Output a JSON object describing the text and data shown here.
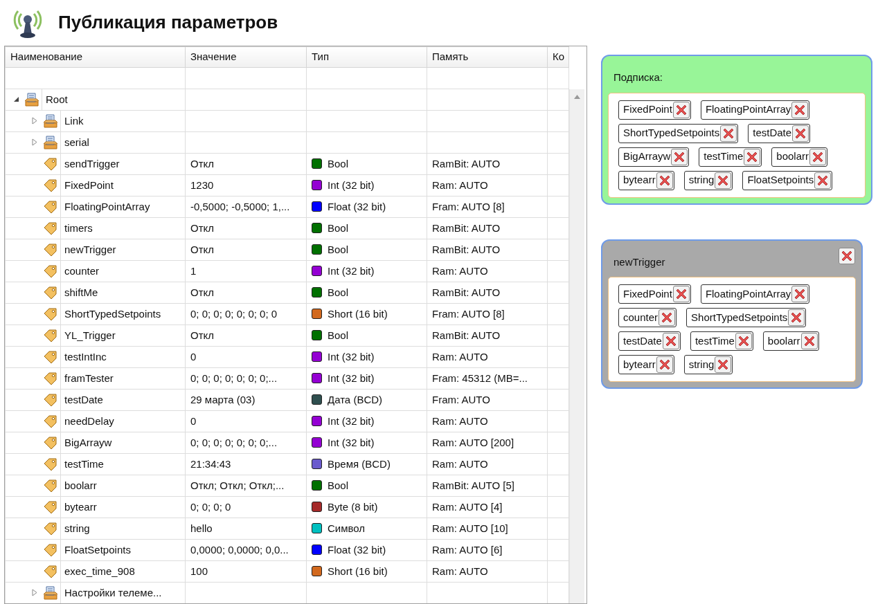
{
  "title": "Публикация параметров",
  "table": {
    "columns": [
      "Наименование",
      "Значение",
      "Тип",
      "Память",
      "Ко"
    ],
    "tree": [
      {
        "kind": "folder",
        "label": "Root",
        "expanded": true,
        "children": [
          {
            "kind": "folder",
            "label": "Link",
            "expanded": false
          },
          {
            "kind": "folder",
            "label": "serial",
            "expanded": false
          },
          {
            "kind": "param",
            "label": "sendTrigger",
            "value": "Откл",
            "type": "Bool",
            "color": "#007000",
            "memory": "RamBit: AUTO"
          },
          {
            "kind": "param",
            "label": "FixedPoint",
            "value": "1230",
            "type": "Int (32 bit)",
            "color": "#9400d3",
            "memory": "Ram: AUTO"
          },
          {
            "kind": "param",
            "label": "FloatingPointArray",
            "value": "-0,5000; -0,5000; 1,...",
            "type": "Float (32 bit)",
            "color": "#0000ff",
            "memory": "Fram: AUTO [8]"
          },
          {
            "kind": "param",
            "label": "timers",
            "value": "Откл",
            "type": "Bool",
            "color": "#007000",
            "memory": "RamBit: AUTO"
          },
          {
            "kind": "param",
            "label": "newTrigger",
            "value": "Откл",
            "type": "Bool",
            "color": "#007000",
            "memory": "RamBit: AUTO"
          },
          {
            "kind": "param",
            "label": "counter",
            "value": "1",
            "type": "Int (32 bit)",
            "color": "#9400d3",
            "memory": "Ram: AUTO"
          },
          {
            "kind": "param",
            "label": "shiftMe",
            "value": "Откл",
            "type": "Bool",
            "color": "#007000",
            "memory": "RamBit: AUTO"
          },
          {
            "kind": "param",
            "label": "ShortTypedSetpoints",
            "value": "0; 0; 0; 0; 0; 0; 0; 0",
            "type": "Short (16 bit)",
            "color": "#d2691e",
            "memory": "Fram: AUTO [8]"
          },
          {
            "kind": "param",
            "label": "YL_Trigger",
            "value": "Откл",
            "type": "Bool",
            "color": "#007000",
            "memory": "RamBit: AUTO"
          },
          {
            "kind": "param",
            "label": "testIntInc",
            "value": "0",
            "type": "Int (32 bit)",
            "color": "#9400d3",
            "memory": "Ram: AUTO"
          },
          {
            "kind": "param",
            "label": "framTester",
            "value": "0; 0; 0; 0; 0; 0; 0;...",
            "type": "Int (32 bit)",
            "color": "#9400d3",
            "memory": "Fram: 45312 (MB=..."
          },
          {
            "kind": "param",
            "label": "testDate",
            "value": "29 марта (03)",
            "type": "Дата (BCD)",
            "color": "#2f4f4f",
            "memory": "Fram: AUTO"
          },
          {
            "kind": "param",
            "label": "needDelay",
            "value": "0",
            "type": "Int (32 bit)",
            "color": "#9400d3",
            "memory": "Ram: AUTO"
          },
          {
            "kind": "param",
            "label": "BigArrayw",
            "value": "0; 0; 0; 0; 0; 0; 0;...",
            "type": "Int (32 bit)",
            "color": "#9400d3",
            "memory": "Ram: AUTO [200]"
          },
          {
            "kind": "param",
            "label": "testTime",
            "value": "21:34:43",
            "type": "Время (BCD)",
            "color": "#6a5acd",
            "memory": "Ram: AUTO"
          },
          {
            "kind": "param",
            "label": "boolarr",
            "value": "Откл; Откл; Откл;...",
            "type": "Bool",
            "color": "#007000",
            "memory": "RamBit: AUTO [5]"
          },
          {
            "kind": "param",
            "label": "bytearr",
            "value": "0; 0; 0; 0",
            "type": "Byte (8 bit)",
            "color": "#a52a2a",
            "memory": "Ram: AUTO [4]"
          },
          {
            "kind": "param",
            "label": "string",
            "value": "hello",
            "type": "Символ",
            "color": "#00c0c0",
            "memory": "Ram: AUTO [10]"
          },
          {
            "kind": "param",
            "label": "FloatSetpoints",
            "value": "0,0000; 0,0000; 0,0...",
            "type": "Float (32 bit)",
            "color": "#0000ff",
            "memory": "Ram: AUTO [6]"
          },
          {
            "kind": "param",
            "label": "exec_time_908",
            "value": "100",
            "type": "Short (16 bit)",
            "color": "#d2691e",
            "memory": "Ram: AUTO"
          },
          {
            "kind": "folder",
            "label": "Настройки телеме...",
            "expanded": false
          }
        ]
      }
    ]
  },
  "panels": [
    {
      "kind": "subscription",
      "title": "Подписка:",
      "items": [
        "FixedPoint",
        "FloatingPointArray",
        "ShortTypedSetpoints",
        "testDate",
        "BigArrayw",
        "testTime",
        "boolarr",
        "bytearr",
        "string",
        "FloatSetpoints"
      ]
    },
    {
      "kind": "trigger",
      "title": "newTrigger",
      "items": [
        "FixedPoint",
        "FloatingPointArray",
        "counter",
        "ShortTypedSetpoints",
        "testDate",
        "testTime",
        "boolarr",
        "bytearr",
        "string"
      ]
    }
  ]
}
